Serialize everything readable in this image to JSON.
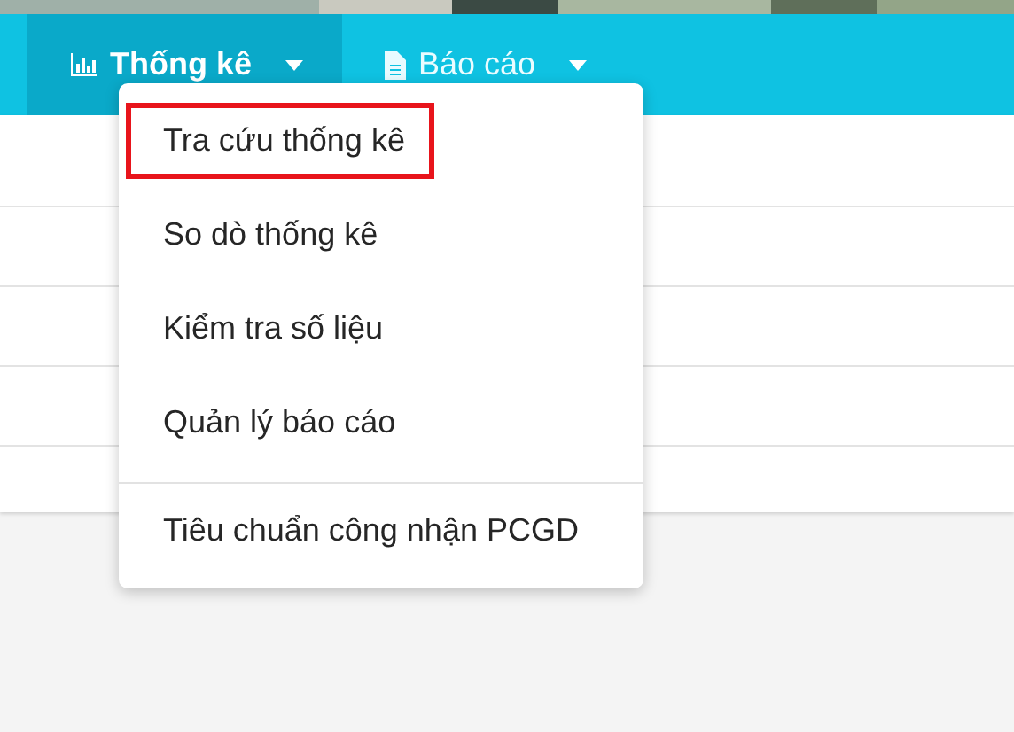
{
  "nav": [
    {
      "label": "Thống kê",
      "kind": "chart",
      "selected": true
    },
    {
      "label": "Báo cáo",
      "kind": "document",
      "selected": false
    }
  ],
  "dropdown": {
    "items": [
      {
        "kind": "item",
        "label": "Tra cứu thống kê",
        "highlighted": true
      },
      {
        "kind": "item",
        "label": "So dò thống kê",
        "highlighted": false
      },
      {
        "kind": "item",
        "label": "Kiểm tra số liệu",
        "highlighted": false
      },
      {
        "kind": "item",
        "label": "Quản lý báo cáo",
        "highlighted": false
      },
      {
        "kind": "divider"
      },
      {
        "kind": "item",
        "label": "Tiêu chuẩn công nhận PCGD",
        "highlighted": false
      }
    ]
  }
}
